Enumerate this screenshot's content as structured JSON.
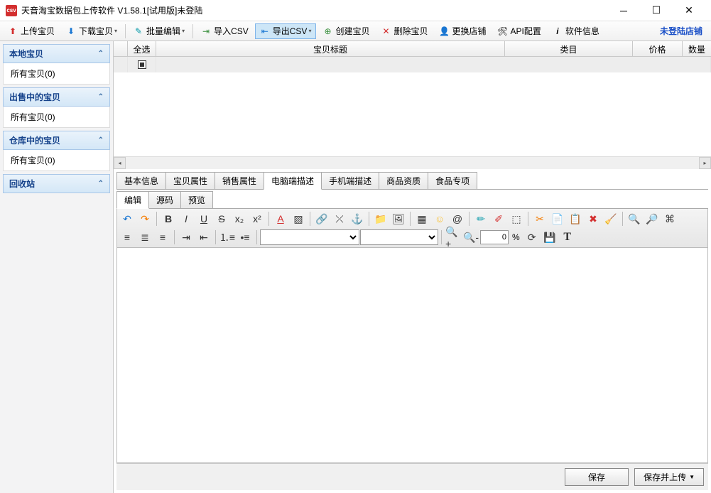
{
  "window": {
    "title": "天音淘宝数据包上传软件 V1.58.1[试用版]未登陆"
  },
  "toolbar": {
    "upload": "上传宝贝",
    "download": "下载宝贝",
    "batch_edit": "批量编辑",
    "import_csv": "导入CSV",
    "export_csv": "导出CSV",
    "create": "创建宝贝",
    "delete": "删除宝贝",
    "switch_shop": "更换店铺",
    "api_config": "API配置",
    "soft_info": "软件信息",
    "login_status": "未登陆店铺"
  },
  "sidebar": {
    "groups": [
      {
        "title": "本地宝贝",
        "items": [
          "所有宝贝(0)"
        ]
      },
      {
        "title": "出售中的宝贝",
        "items": [
          "所有宝贝(0)"
        ]
      },
      {
        "title": "仓库中的宝贝",
        "items": [
          "所有宝贝(0)"
        ]
      },
      {
        "title": "回收站",
        "items": []
      }
    ]
  },
  "grid": {
    "cols": [
      "全选",
      "宝贝标题",
      "类目",
      "价格",
      "数量"
    ]
  },
  "tabs": {
    "main": [
      "基本信息",
      "宝贝属性",
      "销售属性",
      "电脑端描述",
      "手机端描述",
      "商品资质",
      "食品专项"
    ],
    "main_active": 3,
    "sub": [
      "编辑",
      "源码",
      "预览"
    ],
    "sub_active": 0
  },
  "editor": {
    "zoom": "0",
    "pct": "%"
  },
  "bottom": {
    "save": "保存",
    "save_upload": "保存并上传"
  }
}
